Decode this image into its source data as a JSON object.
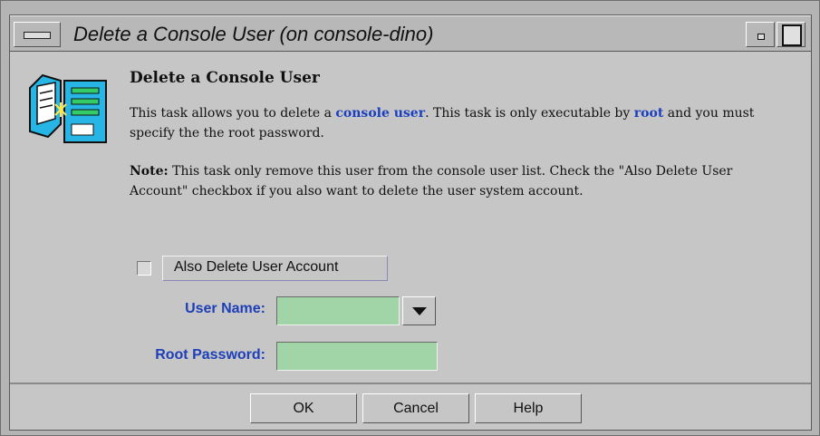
{
  "window": {
    "title": "Delete a Console User (on console-dino)"
  },
  "header": {
    "heading": "Delete a Console User",
    "icon": "console-user-task-icon"
  },
  "description": {
    "p1_before": "This task allows you to delete a ",
    "p1_link1": "console user",
    "p1_middle": ". This task is only executable by ",
    "p1_link2": "root",
    "p1_after": " and you must specify the the root password.",
    "note_label": "Note:",
    "note_text": " This task only remove this user from the console user list. Check the \"Also Delete User Account\" checkbox if you also want to delete the user system account."
  },
  "form": {
    "also_delete_label": "Also Delete User Account",
    "also_delete_checked": false,
    "user_name_label": "User Name:",
    "user_name_value": "",
    "root_password_label": "Root Password:",
    "root_password_value": ""
  },
  "buttons": {
    "ok": "OK",
    "cancel": "Cancel",
    "help": "Help"
  },
  "colors": {
    "field_bg": "#a1d4a6",
    "link": "#1b3fbf",
    "label_blue": "#1d3fb8"
  }
}
